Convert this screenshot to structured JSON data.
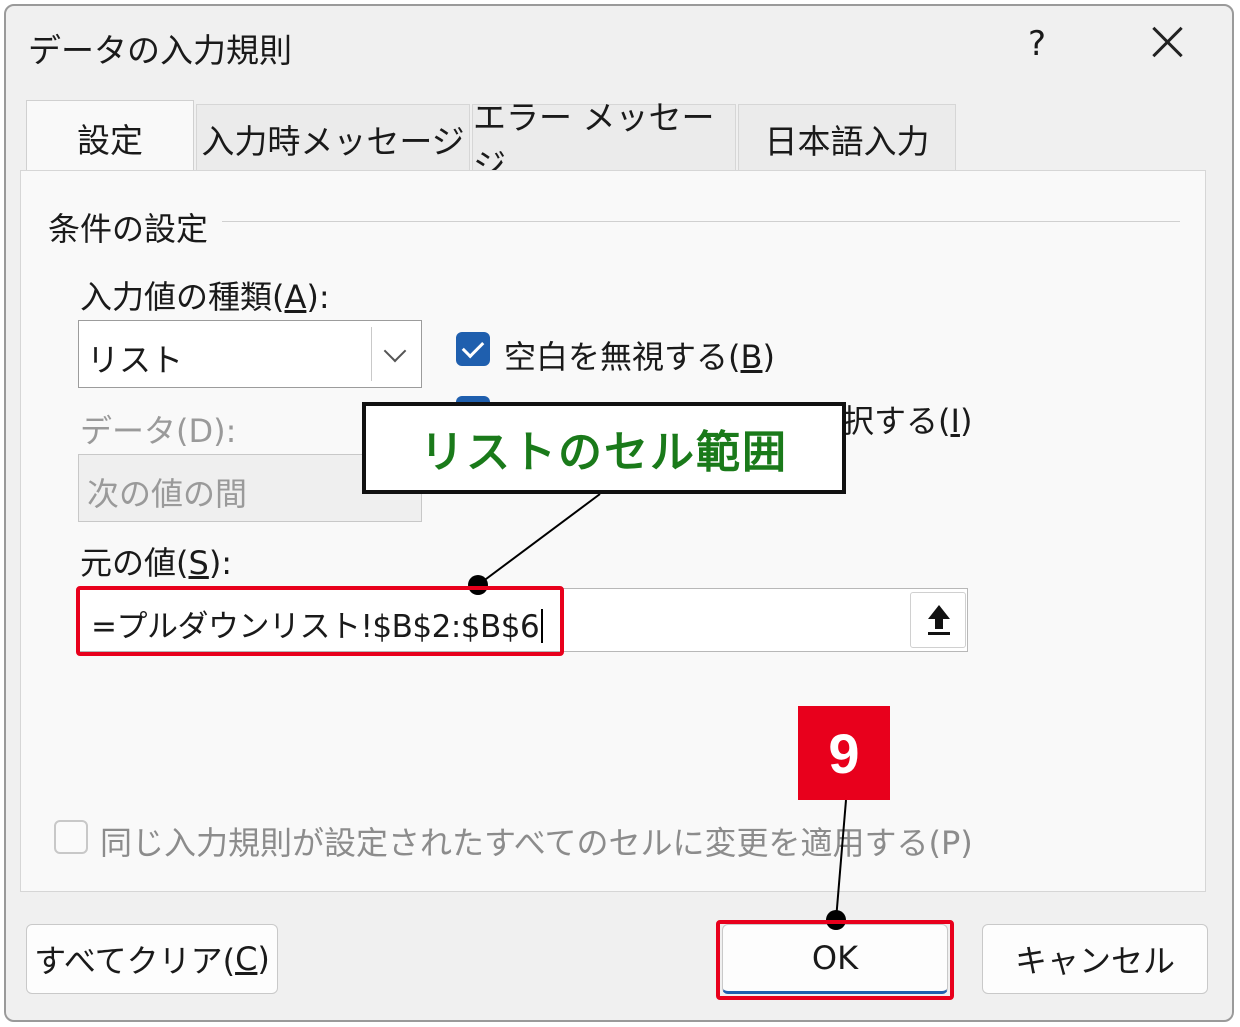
{
  "dialog": {
    "title": "データの入力規則",
    "help_label": "?",
    "tabs": [
      {
        "label": "設定",
        "active": true
      },
      {
        "label": "入力時メッセージ"
      },
      {
        "label": "エラー メッセージ"
      },
      {
        "label": "日本語入力"
      }
    ],
    "section_title": "条件の設定",
    "allow": {
      "label_prefix": "入力値の種類(",
      "label_key": "A",
      "label_suffix": "):",
      "value": "リスト"
    },
    "data": {
      "label": "データ(D):",
      "value": "次の値の間"
    },
    "ignore_blank": {
      "label_prefix": "空白を無視する(",
      "label_key": "B",
      "label_suffix": ")",
      "checked": true
    },
    "in_cell_dropdown": {
      "visible_label_prefix": "択する(",
      "label_key": "I",
      "label_suffix": ")",
      "checked": true
    },
    "source": {
      "label_prefix": "元の値(",
      "label_key": "S",
      "label_suffix": "):",
      "value": "=プルダウンリスト!$B$2:$B$6"
    },
    "apply_all": {
      "label": "同じ入力規則が設定されたすべてのセルに変更を適用する(P)",
      "checked": false
    },
    "buttons": {
      "clear_prefix": "すべてクリア(",
      "clear_key": "C",
      "clear_suffix": ")",
      "ok": "OK",
      "cancel": "キャンセル"
    }
  },
  "annotations": {
    "callout_text": "リストのセル範囲",
    "step_number": "9",
    "highlight_color": "#e8001c",
    "callout_text_color": "#1a7a1a"
  },
  "colors": {
    "checkbox_accent": "#1f5fae",
    "dialog_bg": "#f0f0f0"
  }
}
